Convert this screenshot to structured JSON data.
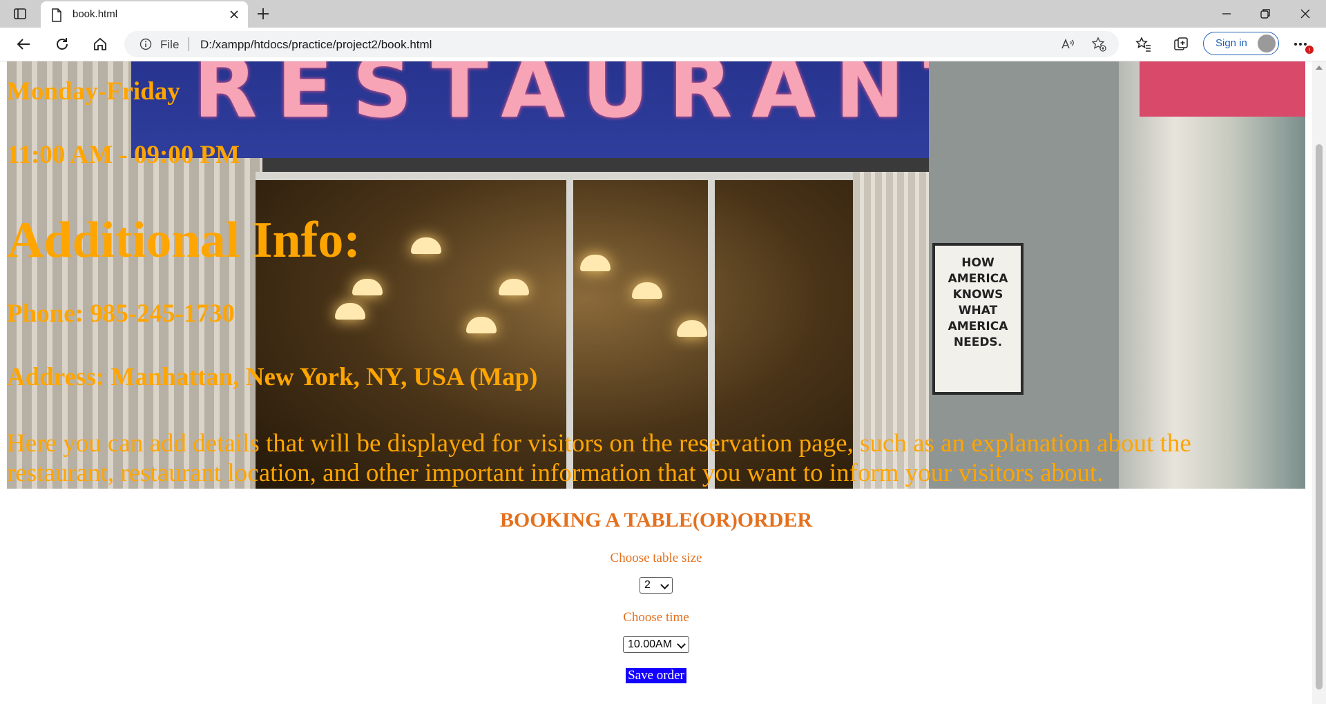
{
  "browser": {
    "tab": {
      "title": "book.html"
    },
    "address": {
      "scheme_label": "File",
      "url": "D:/xampp/htdocs/practice/project2/book.html"
    },
    "signin_label": "Sign in"
  },
  "hero": {
    "days": "Monday-Friday",
    "hours": "11:00 AM - 09:00 PM",
    "additional_info": "Additional Info:",
    "phone": "Phone: 985-245-1730",
    "address": "Address: Manhattan, New York, NY, USA (Map)",
    "description": "Here you can add details that will be displayed for visitors on the reservation page, such as an explanation about the restaurant, restaurant location, and other important information that you want to inform your visitors about.",
    "photo": {
      "sign_text": "RESTAURANT",
      "poster_text": "HOW AMERICA KNOWS WHAT AMERICA NEEDS."
    }
  },
  "booking": {
    "title": "BOOKING A TABLE(OR)ORDER",
    "table_size_label": "Choose table size",
    "table_size_value": "2",
    "time_label": "Choose time",
    "time_value": "10.00AM",
    "save_label": "Save order"
  },
  "colors": {
    "hero_text": "#ffa500",
    "booking_text": "#e4701d",
    "save_button_bg": "#1400ff",
    "signin_accent": "#1f5fb8"
  }
}
